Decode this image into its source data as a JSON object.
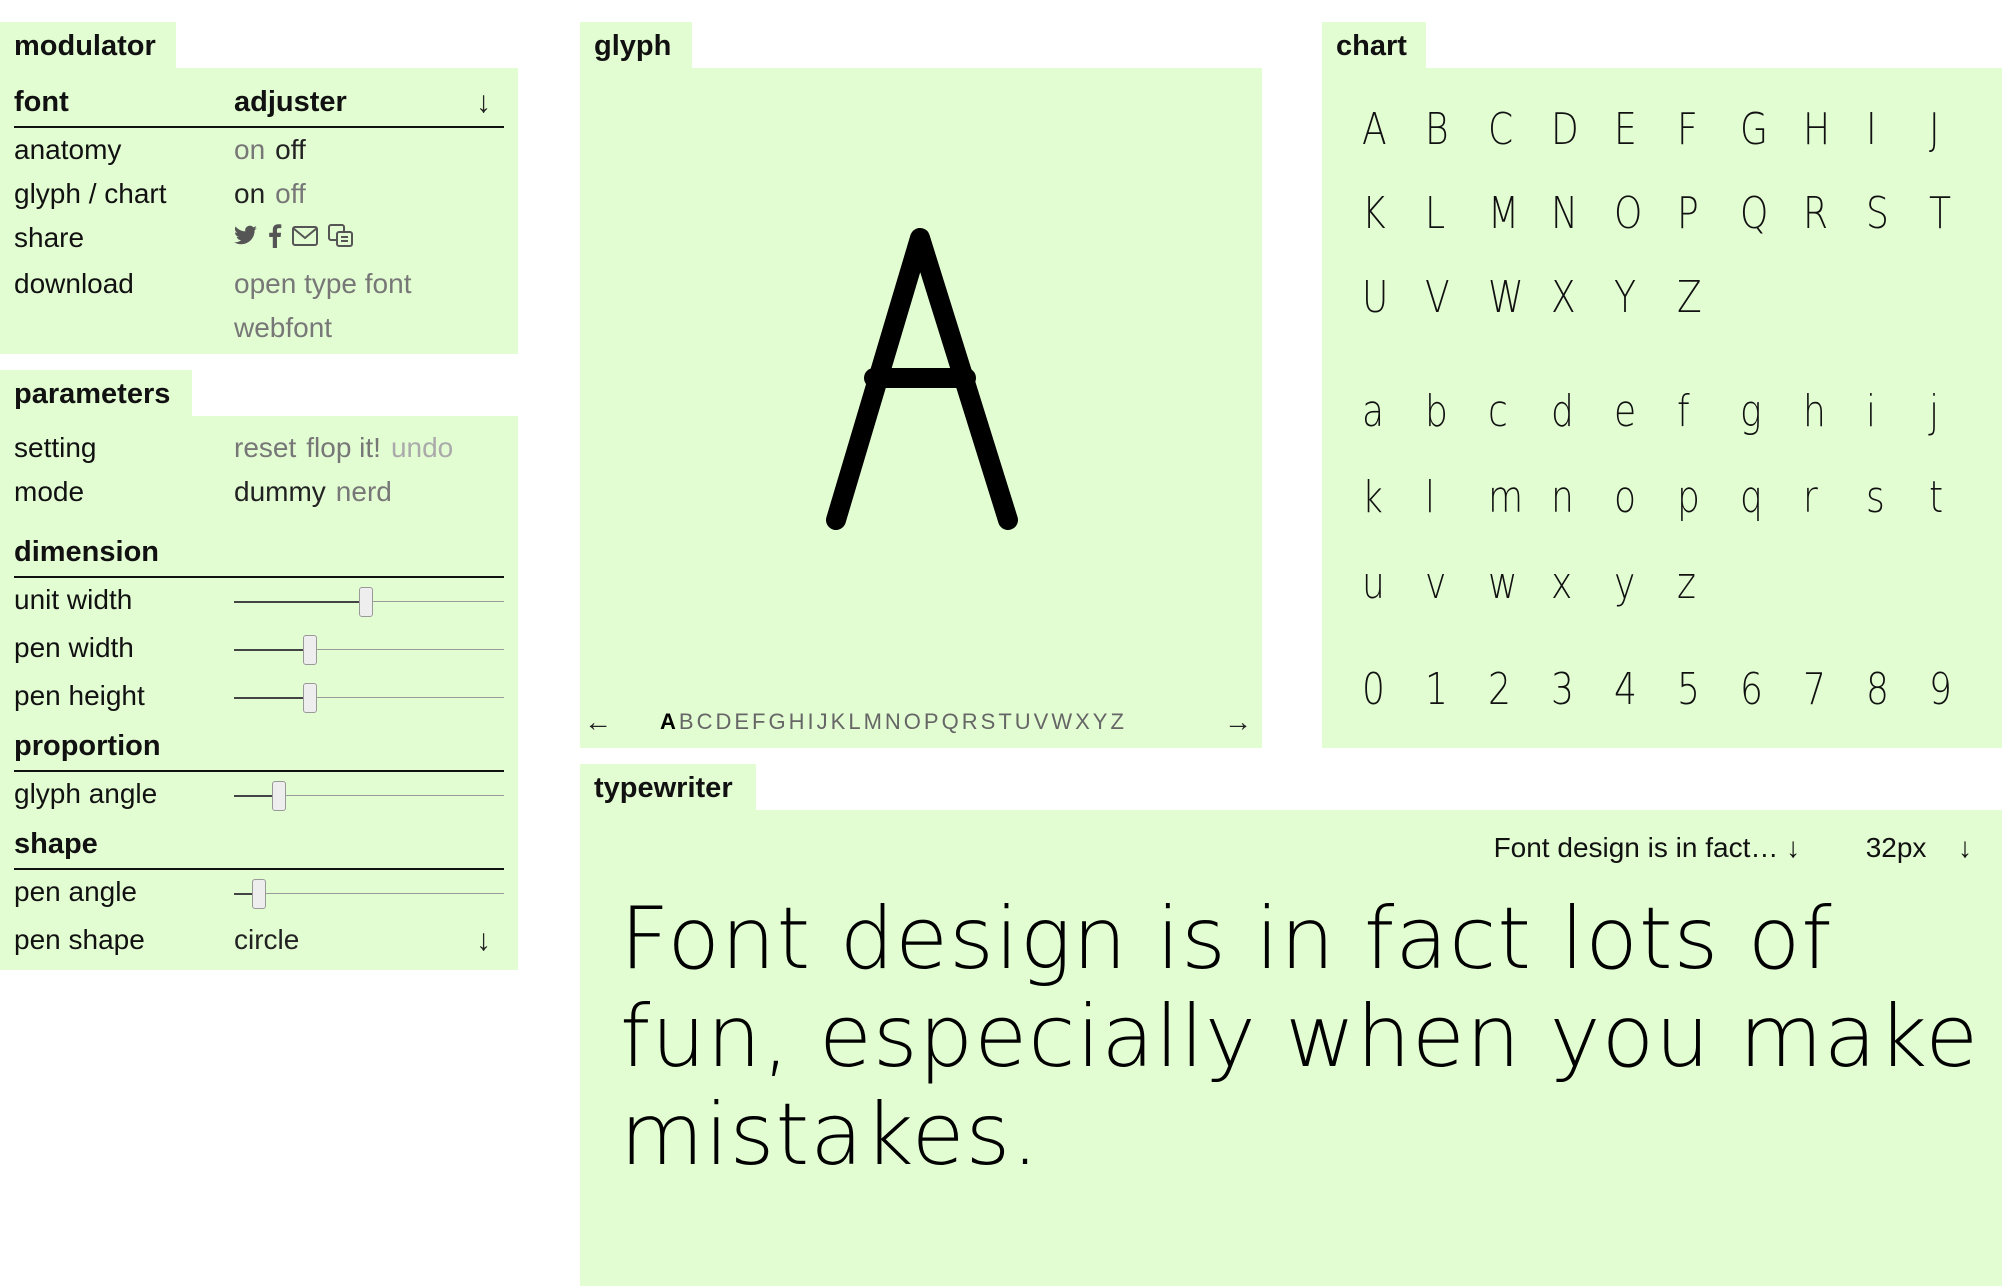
{
  "modulator": {
    "title": "modulator",
    "col_font": "font",
    "col_adjuster": "adjuster",
    "rows": {
      "anatomy": {
        "label": "anatomy",
        "on": "on",
        "off": "off"
      },
      "glyph_chart": {
        "label": "glyph / chart",
        "on": "on",
        "off": "off"
      },
      "share": {
        "label": "share",
        "icons": [
          "twitter-icon",
          "facebook-icon",
          "mail-icon",
          "copy-icon"
        ]
      },
      "download": {
        "label": "download",
        "otf": "open type font",
        "webfont": "webfont"
      }
    }
  },
  "parameters": {
    "title": "parameters",
    "setting": {
      "label": "setting",
      "reset": "reset",
      "flop": "flop it!",
      "undo": "undo"
    },
    "mode": {
      "label": "mode",
      "dummy": "dummy",
      "nerd": "nerd"
    },
    "dimension": {
      "title": "dimension",
      "unit_width": {
        "label": "unit width",
        "value": 0.49
      },
      "pen_width": {
        "label": "pen width",
        "value": 0.27
      },
      "pen_height": {
        "label": "pen height",
        "value": 0.27
      }
    },
    "proportion": {
      "title": "proportion",
      "glyph_angle": {
        "label": "glyph angle",
        "value": 0.15
      }
    },
    "shape": {
      "title": "shape",
      "pen_angle": {
        "label": "pen angle",
        "value": 0.07
      },
      "pen_shape": {
        "label": "pen shape",
        "value": "circle"
      }
    }
  },
  "glyph": {
    "title": "glyph",
    "current": "A",
    "letters": [
      "A",
      "B",
      "C",
      "D",
      "E",
      "F",
      "G",
      "H",
      "I",
      "J",
      "K",
      "L",
      "M",
      "N",
      "O",
      "P",
      "Q",
      "R",
      "S",
      "T",
      "U",
      "V",
      "W",
      "X",
      "Y",
      "Z"
    ],
    "prev_arrow": "←",
    "next_arrow": "→"
  },
  "chart": {
    "title": "chart",
    "rows": [
      [
        "A",
        "B",
        "C",
        "D",
        "E",
        "F",
        "G",
        "H",
        "I",
        "J"
      ],
      [
        "K",
        "L",
        "M",
        "N",
        "O",
        "P",
        "Q",
        "R",
        "S",
        "T"
      ],
      [
        "U",
        "V",
        "W",
        "X",
        "Y",
        "Z"
      ],
      [
        "a",
        "b",
        "c",
        "d",
        "e",
        "f",
        "g",
        "h",
        "i",
        "j"
      ],
      [
        "k",
        "l",
        "m",
        "n",
        "o",
        "p",
        "q",
        "r",
        "s",
        "t"
      ],
      [
        "u",
        "v",
        "w",
        "x",
        "y",
        "z"
      ],
      [
        "0",
        "1",
        "2",
        "3",
        "4",
        "5",
        "6",
        "7",
        "8",
        "9"
      ]
    ]
  },
  "typewriter": {
    "title": "typewriter",
    "preset": "Font design is in fact…",
    "size": "32px",
    "text": "Font design is in fact lots of fun, especially when you make mistakes."
  },
  "colors": {
    "panel_bg": "#e3fdd3",
    "text": "#111111"
  }
}
